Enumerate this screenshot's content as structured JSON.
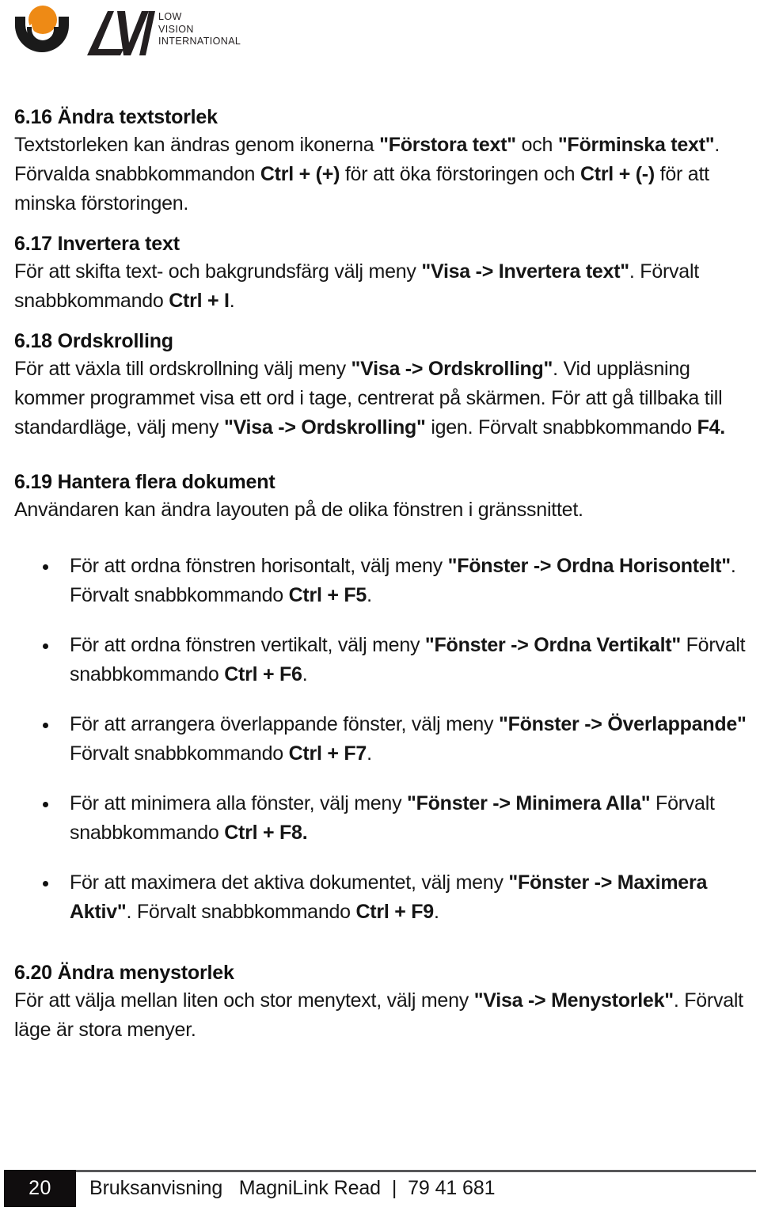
{
  "logo": {
    "brand": "LVI",
    "tagline_lines": [
      "LOW",
      "VISION",
      "INTERNATIONAL"
    ],
    "mark_circle_color": "#EE8A15",
    "mark_bowl_color": "#1A1A1A",
    "wordmark_color": "#231F20"
  },
  "sections": [
    {
      "id": "6.16",
      "heading": "6.16 Ändra textstorlek",
      "paragraph_runs": [
        {
          "t": "Textstorleken kan ändras genom ikonerna ",
          "b": false
        },
        {
          "t": "\"Förstora text\"",
          "b": true
        },
        {
          "t": " och ",
          "b": false
        },
        {
          "t": "\"Förminska text\"",
          "b": true
        },
        {
          "t": ". Förvalda snabbkommandon ",
          "b": false
        },
        {
          "t": "Ctrl + (+)",
          "b": true
        },
        {
          "t": " för att öka förstoringen och ",
          "b": false
        },
        {
          "t": "Ctrl + (-)",
          "b": true
        },
        {
          "t": " för att minska förstoringen.",
          "b": false
        }
      ]
    },
    {
      "id": "6.17",
      "heading": "6.17 Invertera text",
      "paragraph_runs": [
        {
          "t": "För att skifta text- och bakgrundsfärg välj meny ",
          "b": false
        },
        {
          "t": "\"Visa -> Invertera text\"",
          "b": true
        },
        {
          "t": ". Förvalt snabbkommando ",
          "b": false
        },
        {
          "t": "Ctrl + I",
          "b": true
        },
        {
          "t": ".",
          "b": false
        }
      ]
    },
    {
      "id": "6.18",
      "heading": "6.18 Ordskrolling",
      "paragraph_runs": [
        {
          "t": "För att växla till ordskrollning välj meny ",
          "b": false
        },
        {
          "t": "\"Visa -> Ordskrolling\"",
          "b": true
        },
        {
          "t": ". Vid uppläsning kommer programmet visa ett ord i tage, centrerat på skärmen. För att gå tillbaka till standardläge, välj meny ",
          "b": false
        },
        {
          "t": "\"Visa -> Ordskrolling\"",
          "b": true
        },
        {
          "t": " igen. Förvalt snabbkommando ",
          "b": false
        },
        {
          "t": "F4.",
          "b": true
        }
      ]
    },
    {
      "id": "6.19",
      "heading": "6.19 Hantera flera dokument",
      "paragraph_runs": [
        {
          "t": "Användaren kan ändra layouten på de olika fönstren i gränssnittet.",
          "b": false
        }
      ],
      "bullets": [
        [
          {
            "t": "För att ordna fönstren horisontalt, välj meny ",
            "b": false
          },
          {
            "t": "\"Fönster -> Ordna Horisontelt\"",
            "b": true
          },
          {
            "t": ". Förvalt snabbkommando ",
            "b": false
          },
          {
            "t": "Ctrl + F5",
            "b": true
          },
          {
            "t": ".",
            "b": false
          }
        ],
        [
          {
            "t": "För att ordna fönstren vertikalt, välj meny ",
            "b": false
          },
          {
            "t": "\"Fönster -> Ordna Vertikalt\"",
            "b": true
          },
          {
            "t": " Förvalt snabbkommando ",
            "b": false
          },
          {
            "t": "Ctrl + F6",
            "b": true
          },
          {
            "t": ".",
            "b": false
          }
        ],
        [
          {
            "t": "För att arrangera  överlappande fönster, välj meny ",
            "b": false
          },
          {
            "t": "\"Fönster -> Överlappande\"",
            "b": true
          },
          {
            "t": " Förvalt snabbkommando ",
            "b": false
          },
          {
            "t": "Ctrl + F7",
            "b": true
          },
          {
            "t": ".",
            "b": false
          }
        ],
        [
          {
            "t": "För att minimera alla fönster, välj meny ",
            "b": false
          },
          {
            "t": "\"Fönster -> Minimera Alla\"",
            "b": true
          },
          {
            "t": " Förvalt snabbkommando ",
            "b": false
          },
          {
            "t": "Ctrl + F8.",
            "b": true
          }
        ],
        [
          {
            "t": "För att maximera det aktiva dokumentet, välj meny ",
            "b": false
          },
          {
            "t": "\"Fönster -> Maximera Aktiv\"",
            "b": true
          },
          {
            "t": ". Förvalt snabbkommando ",
            "b": false
          },
          {
            "t": "Ctrl + F9",
            "b": true
          },
          {
            "t": ".",
            "b": false
          }
        ]
      ]
    },
    {
      "id": "6.20",
      "heading": "6.20 Ändra menystorlek",
      "paragraph_runs": [
        {
          "t": "För att välja mellan liten och stor menytext, välj meny ",
          "b": false
        },
        {
          "t": "\"Visa -> Menystorlek\"",
          "b": true
        },
        {
          "t": ". Förvalt läge är stora menyer.",
          "b": false
        }
      ]
    }
  ],
  "footer": {
    "page_number": "20",
    "manual_label": "Bruksanvisning",
    "product_name": "MagniLink Read",
    "separator": "|",
    "article_number": "79 41 681",
    "rule_color": "#58585A",
    "badge_bg": "#100D0E"
  }
}
